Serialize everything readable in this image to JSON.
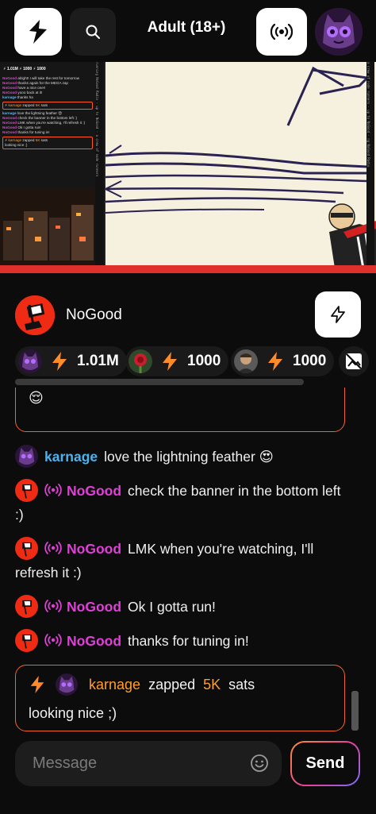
{
  "header": {
    "title": "Adult (18+)",
    "logo_icon": "zap-stream-logo-icon",
    "search_icon": "search-icon",
    "live_icon": "broadcast-icon"
  },
  "stream_video": {
    "overlay_stats": "⚡ 1.01M   ⚡ 1000   ⚡ 1000",
    "overlay_chat": [
      {
        "user": "NoGood",
        "text": "alright! I will take the rest for tomorrow"
      },
      {
        "user": "NoGood",
        "text": "thanks again for the MEGA zap"
      },
      {
        "user": "NoGood",
        "text": "have a nice one!!"
      },
      {
        "user": "NoGood",
        "text": "yooo back at it!"
      },
      {
        "user": "karnage",
        "text": "thanks ha"
      },
      {
        "zap_user": "karnage",
        "zap_text": "zapped",
        "zap_amount": "5K",
        "zap_unit": "sats"
      },
      {
        "user": "karnage",
        "text": "love the lightning feather 😍"
      },
      {
        "user": "NoGood",
        "text": "check the banner in the bottom left :)"
      },
      {
        "user": "NoGood",
        "text": "LMK when you're watching, I'll refresh it :)"
      },
      {
        "user": "NoGood",
        "text": "Ok I gotta run!"
      },
      {
        "user": "NoGood",
        "text": "thanks for tuning in!"
      },
      {
        "zap_user": "karnage",
        "zap_text": "zapped",
        "zap_amount": "5K",
        "zap_unit": "sats"
      },
      {
        "text": "looking nice ;)"
      }
    ]
  },
  "channel": {
    "name": "NoGood",
    "zap_button_icon": "lightning-bolt-icon"
  },
  "top_zappers": [
    {
      "amount": "1.01M",
      "avatar": "cat-avatar"
    },
    {
      "amount": "1000",
      "avatar": "rose-avatar"
    },
    {
      "amount": "1000",
      "avatar": "man-avatar"
    }
  ],
  "chat": {
    "previous_zap_emoji": "😌",
    "messages": [
      {
        "user": "karnage",
        "text": "love the lightning feather 😍"
      },
      {
        "user": "NoGood",
        "text": "check the banner in the bottom left :)"
      },
      {
        "user": "NoGood",
        "text": "LMK when you're watching, I'll refresh it :)"
      },
      {
        "user": "NoGood",
        "text": "Ok I gotta run!"
      },
      {
        "user": "NoGood",
        "text": "thanks for tuning in!"
      }
    ],
    "zap": {
      "user": "karnage",
      "verb": "zapped",
      "amount": "5K",
      "unit": "sats",
      "message": "looking nice ;)"
    }
  },
  "composer": {
    "placeholder": "Message",
    "send_label": "Send"
  },
  "colors": {
    "accent_orange": "#f2642a",
    "karnage_blue": "#4cb3f0",
    "nogood_magenta": "#e03fd8",
    "zap_orange": "#ff9e2c"
  }
}
